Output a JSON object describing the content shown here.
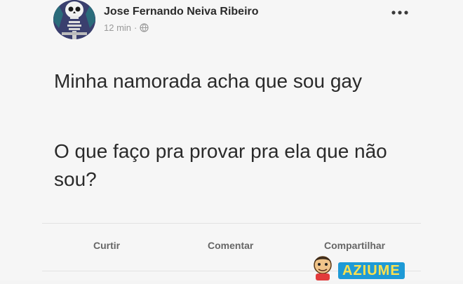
{
  "post": {
    "author": "Jose Fernando Neiva Ribeiro",
    "time": "12 min",
    "separator": "·",
    "privacy_icon": "globe-icon",
    "menu_icon": "more-options-icon",
    "text": {
      "paragraph1": "Minha namorada acha que sou gay",
      "paragraph2": "O que faço pra provar pra ela que não sou?"
    },
    "actions": {
      "like": "Curtir",
      "comment": "Comentar",
      "share": "Compartilhar"
    }
  },
  "watermark": {
    "text": "AZIUME",
    "colors": {
      "text": "#ffe14d",
      "background": "#1e9ad6"
    }
  },
  "colors": {
    "background": "#f6f6f6",
    "author": "#2b2b2b",
    "meta": "#9a9a9a",
    "body_text": "#2a2a2a",
    "action_text": "#666666",
    "divider": "#e3e3e3",
    "avatar_bg": "#3a3f6e"
  }
}
